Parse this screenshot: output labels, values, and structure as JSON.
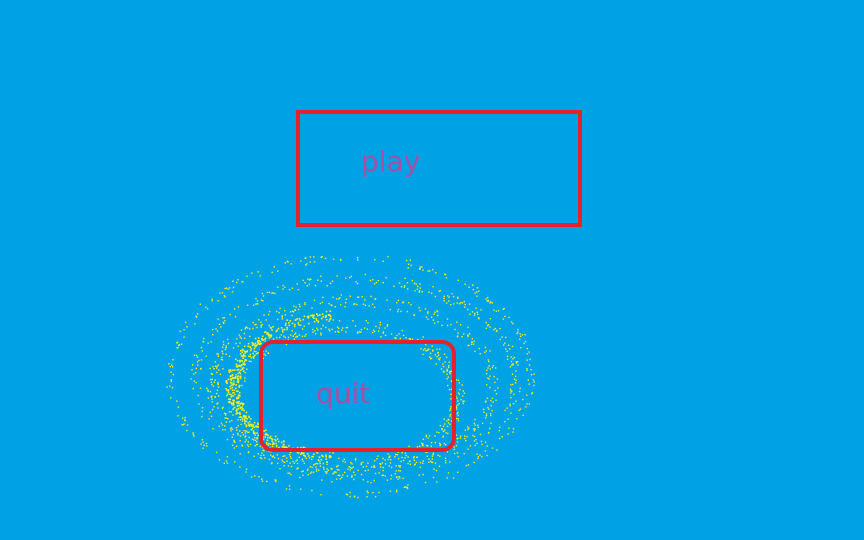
{
  "colors": {
    "background": "#00A2E6",
    "button_border": "#E4222E",
    "label_text": "#A94FA2",
    "particle": "#F4F01C"
  },
  "menu": {
    "play_label": "play",
    "quit_label": "quit"
  },
  "effects": {
    "particle_swirl": "yellow-particle-swirl"
  }
}
